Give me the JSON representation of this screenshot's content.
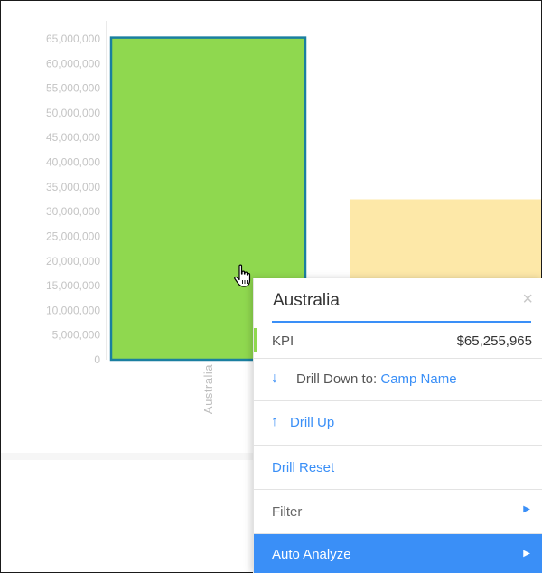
{
  "colors": {
    "bar_fill": "#8fd84f",
    "bar_stroke": "#1a7fa0",
    "background_bar": "#fde8a8",
    "accent_blue": "#3a8ff7",
    "kpi_accent": "#8fd84f"
  },
  "chart_data": {
    "type": "bar",
    "categories": [
      "Australia"
    ],
    "values": [
      65255965
    ],
    "background_bar_value": 32500000,
    "title": "",
    "xlabel": "",
    "ylabel": "",
    "ylim": [
      0,
      65000000
    ],
    "tick_step": 5000000,
    "tick_labels": [
      "0",
      "5,000,000",
      "10,000,000",
      "15,000,000",
      "20,000,000",
      "25,000,000",
      "30,000,000",
      "35,000,000",
      "40,000,000",
      "45,000,000",
      "50,000,000",
      "55,000,000",
      "60,000,000",
      "65,000,000"
    ],
    "grid": false
  },
  "popup": {
    "title": "Australia",
    "close_icon": "close-icon",
    "kpi": {
      "label": "KPI",
      "value": "$65,255,965"
    },
    "drill_down": {
      "prefix": "Drill Down to:",
      "target": "Camp Name",
      "icon": "arrow-down-icon"
    },
    "drill_up": {
      "label": "Drill Up",
      "icon": "arrow-up-icon"
    },
    "drill_reset": {
      "label": "Drill Reset"
    },
    "filter": {
      "label": "Filter",
      "icon": "caret-right-icon"
    },
    "auto_analyze": {
      "label": "Auto Analyze",
      "icon": "caret-right-icon"
    }
  },
  "cursor": {
    "icon": "hand-pointer-icon"
  }
}
